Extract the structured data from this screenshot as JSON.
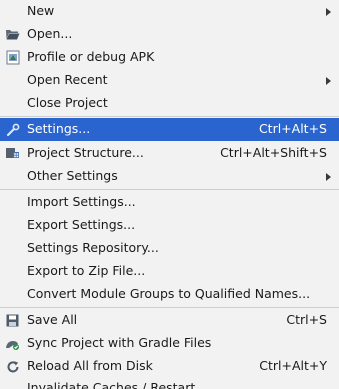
{
  "menu": {
    "new": {
      "label": "New"
    },
    "open": {
      "label": "Open...",
      "icon": "folder-open-icon"
    },
    "profile": {
      "label": "Profile or debug APK",
      "icon": "apk-icon"
    },
    "open_recent": {
      "label": "Open Recent"
    },
    "close_project": {
      "label": "Close Project"
    },
    "settings": {
      "label": "Settings...",
      "shortcut": "Ctrl+Alt+S",
      "icon": "wrench-icon"
    },
    "project_structure": {
      "label": "Project Structure...",
      "shortcut": "Ctrl+Alt+Shift+S",
      "icon": "project-structure-icon"
    },
    "other_settings": {
      "label": "Other Settings"
    },
    "import_settings": {
      "label": "Import Settings..."
    },
    "export_settings": {
      "label": "Export Settings..."
    },
    "settings_repository": {
      "label": "Settings Repository..."
    },
    "export_zip": {
      "label": "Export to Zip File..."
    },
    "convert_modules": {
      "label": "Convert Module Groups to Qualified Names..."
    },
    "save_all": {
      "label": "Save All",
      "shortcut": "Ctrl+S",
      "icon": "save-icon"
    },
    "sync_gradle": {
      "label": "Sync Project with Gradle Files",
      "icon": "gradle-sync-icon"
    },
    "reload_disk": {
      "label": "Reload All from Disk",
      "shortcut": "Ctrl+Alt+Y",
      "icon": "reload-icon"
    },
    "invalidate": {
      "label": "Invalidate Caches / Restart..."
    }
  },
  "colors": {
    "background": "#f2f2f2",
    "selection": "#2a65cf",
    "separator": "#cfcfcf"
  }
}
